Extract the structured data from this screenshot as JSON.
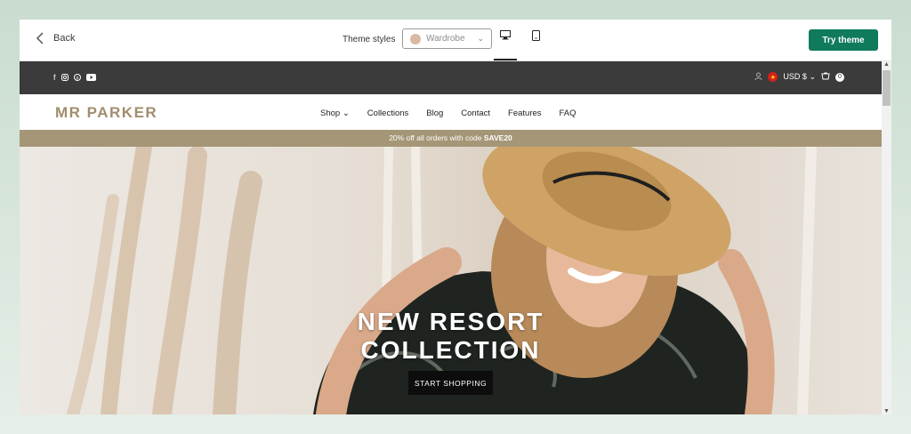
{
  "editor": {
    "back_label": "Back",
    "theme_styles_label": "Theme styles",
    "theme_style_value": "Wardrobe",
    "try_button": "Try theme"
  },
  "store": {
    "currency": "USD $",
    "cart_count": "0",
    "logo": "MR PARKER",
    "nav": [
      "Shop",
      "Collections",
      "Blog",
      "Contact",
      "Features",
      "FAQ"
    ],
    "promo_prefix": "20% off all orders with code ",
    "promo_code": "SAVE20",
    "hero_line1": "NEW RESORT",
    "hero_line2": "COLLECTION",
    "hero_button": "START SHOPPING"
  },
  "colors": {
    "accent": "#0f7a5c",
    "brand": "#a08e6c",
    "promo_bg": "#a49676",
    "topbar_bg": "#3b3b3b"
  }
}
